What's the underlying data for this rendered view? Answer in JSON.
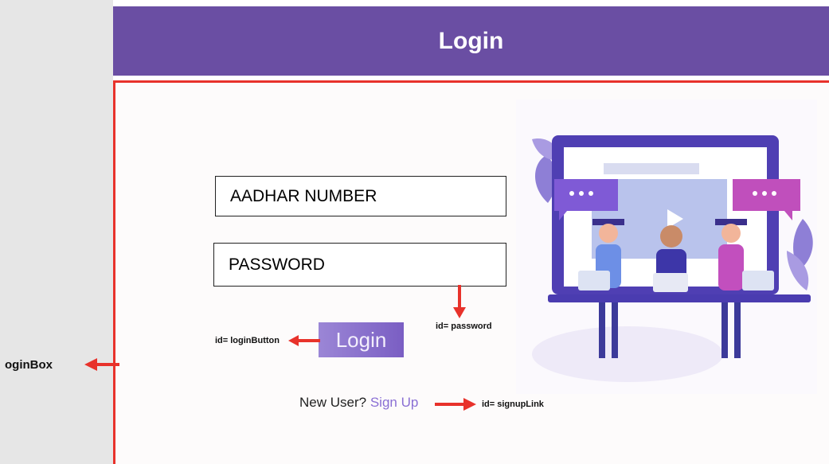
{
  "header": {
    "title": "Login"
  },
  "form": {
    "aadhar_placeholder": "AADHAR NUMBER",
    "password_placeholder": "PASSWORD",
    "login_button": "Login",
    "new_user_text": "New User?",
    "signup_link": "Sign Up"
  },
  "annotations": {
    "login_button_id": "id= loginButton",
    "password_id": "id= password",
    "signup_id": "id= signupLink",
    "loginbox_label": "oginBox"
  },
  "colors": {
    "header_bg": "#6a4ea3",
    "accent_red": "#e8322b",
    "link": "#8a6fd4"
  }
}
